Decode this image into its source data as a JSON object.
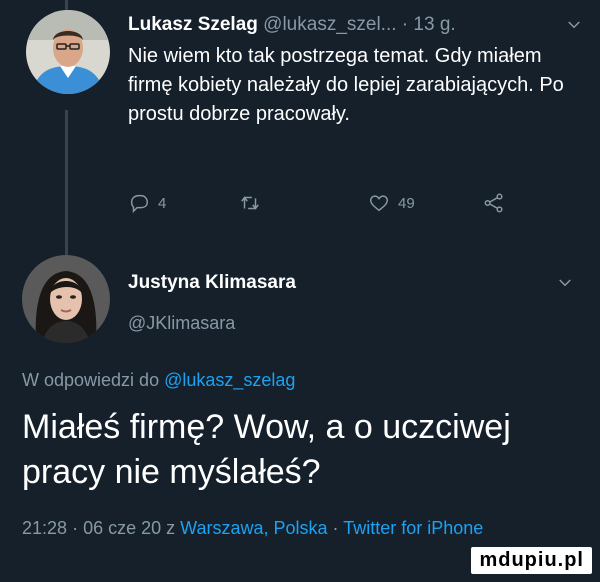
{
  "tweet1": {
    "author_name": "Lukasz Szelag",
    "handle": "@lukasz_szel...",
    "separator": "·",
    "time": "13 g.",
    "body": "Nie wiem kto tak postrzega temat. Gdy miałem firmę kobiety należały do lepiej zarabiających. Po prostu dobrze pracowały.",
    "reply_count": "4",
    "like_count": "49",
    "icons": [
      "reply-icon",
      "retweet-icon",
      "like-icon",
      "share-icon",
      "chevron-down-icon"
    ]
  },
  "tweet2": {
    "author_name": "Justyna Klimasara",
    "handle": "@JKlimasara",
    "reply_prefix": "W odpowiedzi do",
    "reply_to": "@lukasz_szelag",
    "body": "Miałeś firmę? Wow, a o uczciwej pracy nie myślałeś?",
    "time": "21:28",
    "separator": "·",
    "date": "06 cze 20 z",
    "location": "Warszawa, Polska",
    "source": "Twitter for iPhone"
  },
  "watermark": "mdupiu.pl",
  "colors": {
    "background": "#15202b",
    "text": "#ffffff",
    "muted": "#8899a6",
    "link": "#1da1f2",
    "thread_line": "#38444d"
  }
}
